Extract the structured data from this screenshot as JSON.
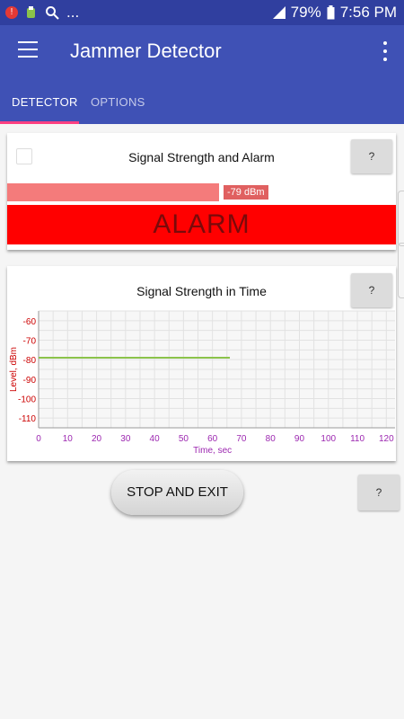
{
  "status_bar": {
    "dots": "...",
    "battery": "79%",
    "time": "7:56 PM",
    "icons": [
      "notification-icon",
      "hand-icon",
      "search-icon",
      "signal-icon",
      "battery-icon"
    ]
  },
  "app_bar": {
    "title": "Jammer Detector",
    "icons": [
      "menu-icon",
      "overflow-menu-icon"
    ]
  },
  "tabs": [
    {
      "label": "DETECTOR",
      "active": true
    },
    {
      "label": "OPTIONS",
      "active": false
    }
  ],
  "alarm_card": {
    "title": "Signal Strength and Alarm",
    "help_label": "?",
    "checkbox_checked": false,
    "signal_dbm_label": "-79 dBm",
    "signal_level_fraction": 0.545,
    "alarm_text": "ALARM",
    "colors": {
      "bar": "#f47b7b",
      "alarm": "#ff0000"
    }
  },
  "chart_card": {
    "title": "Signal Strength in Time",
    "help_label": "?"
  },
  "chart_data": {
    "type": "line",
    "xlabel": "Time, sec",
    "ylabel": "Level, dBm",
    "xlim": [
      0,
      123
    ],
    "ylim": [
      -115,
      -55
    ],
    "x_ticks": [
      0,
      10,
      20,
      30,
      40,
      50,
      60,
      70,
      80,
      90,
      100,
      110,
      120
    ],
    "y_ticks": [
      -60,
      -70,
      -80,
      -90,
      -100,
      -110
    ],
    "grid": true,
    "series": [
      {
        "x": [
          0,
          66
        ],
        "y": [
          -79,
          -79
        ],
        "color": "#8bc34a"
      }
    ]
  },
  "actions": {
    "stop_label": "STOP AND EXIT",
    "help_label": "?"
  }
}
